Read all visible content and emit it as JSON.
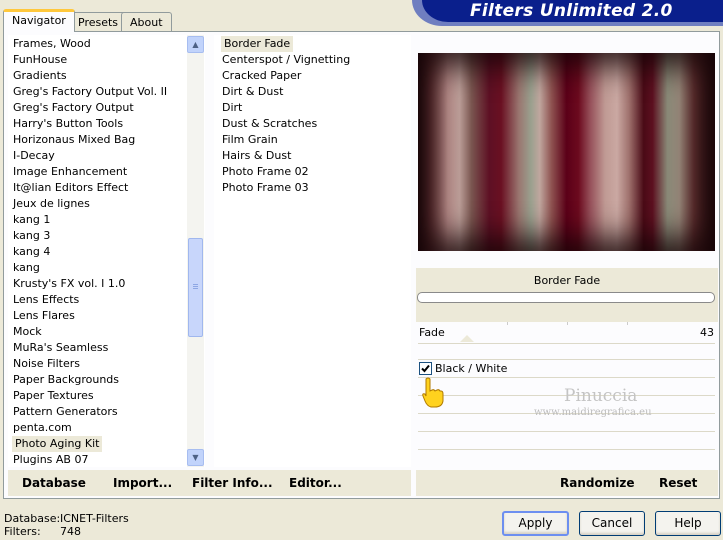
{
  "tabs": [
    {
      "label": "Navigator",
      "active": true
    },
    {
      "label": "Presets",
      "active": false
    },
    {
      "label": "About",
      "active": false
    }
  ],
  "title": "Filters Unlimited 2.0",
  "categories": [
    "Frames, Wood",
    "FunHouse",
    "Gradients",
    "Greg's Factory Output Vol. II",
    "Greg's Factory Output",
    "Harry's Button Tools",
    "Horizonaus Mixed Bag",
    "I-Decay",
    "Image Enhancement",
    "It@lian Editors Effect",
    "Jeux de lignes",
    "kang 1",
    "kang 3",
    "kang 4",
    "kang",
    "Krusty's FX vol. I 1.0",
    "Lens Effects",
    "Lens Flares",
    "Mock",
    "MuRa's Seamless",
    "Noise Filters",
    "Paper Backgrounds",
    "Paper Textures",
    "Pattern Generators",
    "penta.com",
    "Photo Aging Kit",
    "Plugins AB 07"
  ],
  "selected_category": "Photo Aging Kit",
  "filters": [
    "Border Fade",
    "Centerspot / Vignetting",
    "Cracked Paper",
    "Dirt & Dust",
    "Dirt",
    "Dust & Scratches",
    "Film Grain",
    "Hairs & Dust",
    "Photo Frame 02",
    "Photo Frame 03"
  ],
  "selected_filter": "Border Fade",
  "left_buttons": {
    "database": "Database",
    "import": "Import...",
    "filter_info": "Filter Info...",
    "editor": "Editor..."
  },
  "right_buttons": {
    "randomize": "Randomize",
    "reset": "Reset"
  },
  "filter_name": "Border Fade",
  "params": {
    "fade_label": "Fade",
    "fade_value": "43",
    "checkbox_label": "Black / White",
    "checkbox_checked": true
  },
  "watermark": {
    "name": "Pinuccia",
    "url": "www.maidiregrafica.eu"
  },
  "status": {
    "database_label": "Database:",
    "database_value": "ICNET-Filters",
    "filters_label": "Filters:",
    "filters_value": "748"
  },
  "dialog_buttons": {
    "apply": "Apply",
    "cancel": "Cancel",
    "help": "Help"
  },
  "colors": {
    "banner": "#0a1f8c",
    "window_bg": "#ece9d8",
    "tab_highlight": "#ffc83c"
  }
}
